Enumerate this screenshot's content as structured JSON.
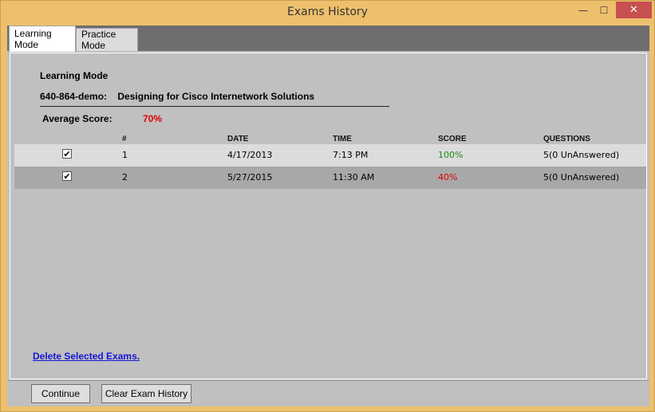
{
  "window": {
    "title": "Exams History",
    "minimize_glyph": "—",
    "maximize_glyph": "☐",
    "close_glyph": "✕"
  },
  "tabs": [
    {
      "label": "Learning Mode",
      "active": true
    },
    {
      "label": "Practice Mode",
      "active": false
    }
  ],
  "panel": {
    "mode_heading": "Learning Mode",
    "exam_code": "640-864-demo:",
    "exam_name": "Designing for Cisco Internetwork Solutions",
    "average_label": "Average Score:",
    "average_value": "70%"
  },
  "table": {
    "columns": [
      "#",
      "DATE",
      "TIME",
      "SCORE",
      "QUESTIONS"
    ],
    "rows": [
      {
        "checked": true,
        "num": "1",
        "date": "4/17/2013",
        "time": "7:13 PM",
        "score": "100%",
        "score_status": "pass",
        "questions": "5(0 UnAnswered)"
      },
      {
        "checked": true,
        "num": "2",
        "date": "5/27/2015",
        "time": "11:30 AM",
        "score": "40%",
        "score_status": "fail",
        "questions": "5(0 UnAnswered)"
      }
    ]
  },
  "links": {
    "delete_selected": "Delete Selected Exams."
  },
  "buttons": {
    "continue": "Continue",
    "clear_history": "Clear Exam History"
  },
  "colors": {
    "window_frame": "#eec06d",
    "panel_bg": "#c0c0c0",
    "tab_strip": "#6e6e6e",
    "pass": "#1a8a1a",
    "fail": "#e00000",
    "link": "#1515d8",
    "close_button": "#c75050"
  },
  "icons": {
    "checkbox_mark": "✔"
  }
}
